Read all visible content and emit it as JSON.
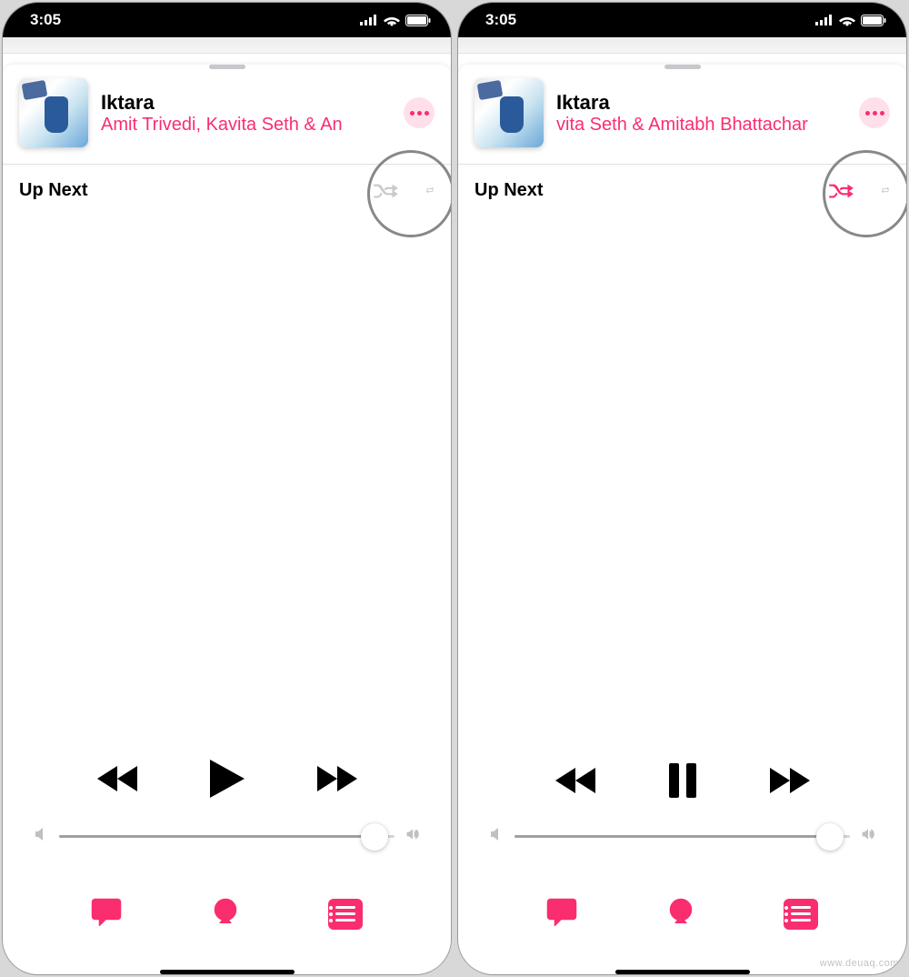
{
  "status": {
    "time": "3:05"
  },
  "accent_color": "#fa2d6e",
  "screens": [
    {
      "now_playing": {
        "title": "Iktara",
        "artist": "Amit Trivedi, Kavita Seth & An"
      },
      "up_next_label": "Up Next",
      "shuffle_active": false,
      "repeat_active": false,
      "playback_state": "paused",
      "volume_percent": 94
    },
    {
      "now_playing": {
        "title": "Iktara",
        "artist": "vita Seth & Amitabh Bhattachar"
      },
      "up_next_label": "Up Next",
      "shuffle_active": true,
      "repeat_active": false,
      "playback_state": "playing",
      "volume_percent": 94
    }
  ],
  "watermark": "www.deuaq.com"
}
